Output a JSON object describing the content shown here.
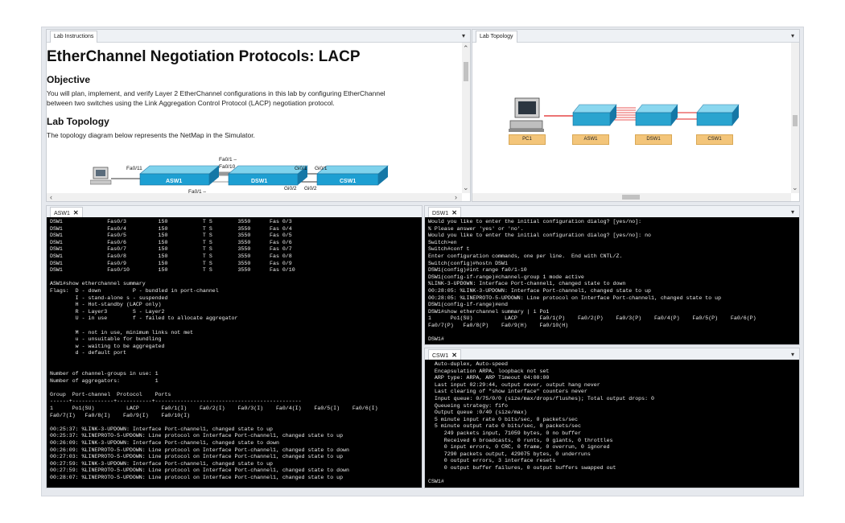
{
  "lab_instructions": {
    "tab": "Lab Instructions",
    "pin": "▾",
    "title": "EtherChannel Negotiation Protocols: LACP",
    "objective_heading": "Objective",
    "objective_text": "You will plan, implement, and verify Layer 2 EtherChannel configurations in this lab by configuring EtherChannel between two switches using the Link Aggregation Control Protocol (LACP) negotiation protocol.",
    "topology_heading": "Lab Topology",
    "topology_text": "The topology diagram below represents the NetMap in the Simulator.",
    "diagram": {
      "asw1": "ASW1",
      "dsw1": "DSW1",
      "csw1": "CSW1",
      "port_fa011": "Fa0/11",
      "port_fa01_top": "Fa0/1 –",
      "port_fa010": "Fa0/10",
      "port_fa01_bottom": "Fa0/1 –",
      "port_gi01_a": "Gi0/1",
      "port_gi01_b": "Gi0/1",
      "port_gi02_a": "Gi0/2",
      "port_gi02_b": "Gi0/2"
    }
  },
  "lab_topology": {
    "tab": "Lab Topology",
    "pin": "▾",
    "nodes": [
      "PC1",
      "ASW1",
      "DSW1",
      "CSW1"
    ],
    "link_color": "#e02020",
    "label_color": "#f3c57a"
  },
  "asw1_console": {
    "tab": "ASW1",
    "close": "✕",
    "lines": [
      "DSW1              Fas0/3          150           T S        3550      Fas 0/3",
      "DSW1              Fas0/4          150           T S        3550      Fas 0/4",
      "DSW1              Fas0/5          150           T S        3550      Fas 0/5",
      "DSW1              Fas0/6          150           T S        3550      Fas 0/6",
      "DSW1              Fas0/7          150           T S        3550      Fas 0/7",
      "DSW1              Fas0/8          150           T S        3550      Fas 0/8",
      "DSW1              Fas0/9          150           T S        3550      Fas 0/9",
      "DSW1              Fas0/10         150           T S        3550      Fas 0/10",
      "",
      "ASW1#show etherchannel summary",
      "Flags:  D - down          P - bundled in port-channel",
      "        I - stand-alone s - suspended",
      "        H - Hot-standby (LACP only)",
      "        R - Layer3        S - Layer2",
      "        U - in use        f - failed to allocate aggregator",
      "",
      "        M - not in use, minimum links not met",
      "        u - unsuitable for bundling",
      "        w - waiting to be aggregated",
      "        d - default port",
      "",
      "",
      "Number of channel-groups in use: 1",
      "Number of aggregators:           1",
      "",
      "Group  Port-channel  Protocol    Ports",
      "------+-------------+-----------+----------------------------------------------",
      "1      Po1(SU)          LACP       Fa0/1(I)    Fa0/2(I)    Fa0/3(I)    Fa0/4(I)    Fa0/5(I)    Fa0/6(I)",
      "Fa0/7(I)   Fa0/8(I)    Fa0/9(I)    Fa0/10(I)",
      "",
      "00:25:37: %LINK-3-UPDOWN: Interface Port-channel1, changed state to up",
      "00:25:37: %LINEPROTO-5-UPDOWN: Line protocol on Interface Port-channel1, changed state to up",
      "00:26:09: %LINK-3-UPDOWN: Interface Port-channel1, changed state to down",
      "00:26:09: %LINEPROTO-5-UPDOWN: Line protocol on Interface Port-channel1, changed state to down",
      "00:27:03: %LINEPROTO-5-UPDOWN: Line protocol on Interface Port-channel1, changed state to up",
      "00:27:59: %LINK-3-UPDOWN: Interface Port-channel1, changed state to up",
      "00:27:59: %LINEPROTO-5-UPDOWN: Line protocol on Interface Port-channel1, changed state to down",
      "00:28:07: %LINEPROTO-5-UPDOWN: Line protocol on Interface Port-channel1, changed state to up"
    ]
  },
  "dsw1_console": {
    "tab": "DSW1",
    "close": "✕",
    "pin": "▾",
    "lines": [
      "Would you like to enter the initial configuration dialog? [yes/no]:",
      "% Please answer 'yes' or 'no'.",
      "Would you like to enter the initial configuration dialog? [yes/no]: no",
      "Switch>en",
      "Switch#conf t",
      "Enter configuration commands, one per line.  End with CNTL/Z.",
      "Switch(config)#hostn DSW1",
      "DSW1(config)#int range fa0/1-10",
      "DSW1(config-if-range)#channel-group 1 mode active",
      "%LINK-3-UPDOWN: Interface Port-channel1, changed state to down",
      "00:28:05: %LINK-3-UPDOWN: Interface Port-channel1, changed state to up",
      "00:28:05: %LINEPROTO-5-UPDOWN: Line protocol on Interface Port-channel1, changed state to up",
      "DSW1(config-if-range)#end",
      "DSW1#show etherchannel summary | i Po1",
      "1      Po1(SU)          LACP       Fa0/1(P)    Fa0/2(P)    Fa0/3(P)    Fa0/4(P)    Fa0/5(P)    Fa0/6(P)",
      "Fa0/7(P)   Fa0/8(P)    Fa0/9(H)    Fa0/10(H)",
      "",
      "DSW1#"
    ]
  },
  "csw1_console": {
    "tab": "CSW1",
    "close": "✕",
    "pin": "▾",
    "lines": [
      "  Auto-duplex, Auto-speed",
      "  Encapsulation ARPA, loopback not set",
      "  ARP type: ARPA, ARP Timeout 04:00:00",
      "  Last input 02:29:44, output never, output hang never",
      "  Last clearing of \"show interface\" counters never",
      "  Input queue: 0/75/0/0 (size/max/drops/flushes); Total output drops: 0",
      "  Queueing strategy: fifo",
      "  Output queue :0/40 (size/max)",
      "  5 minute input rate 0 bits/sec, 0 packets/sec",
      "  5 minute output rate 0 bits/sec, 0 packets/sec",
      "     249 packets input, 71059 bytes, 0 no buffer",
      "     Received 6 broadcasts, 0 runts, 0 giants, 0 throttles",
      "     0 input errors, 0 CRC, 0 frame, 0 overrun, 0 ignored",
      "     7290 packets output, 429075 bytes, 0 underruns",
      "     0 output errors, 3 interface resets",
      "     0 output buffer failures, 0 output buffers swapped out",
      "",
      "CSW1#"
    ]
  }
}
